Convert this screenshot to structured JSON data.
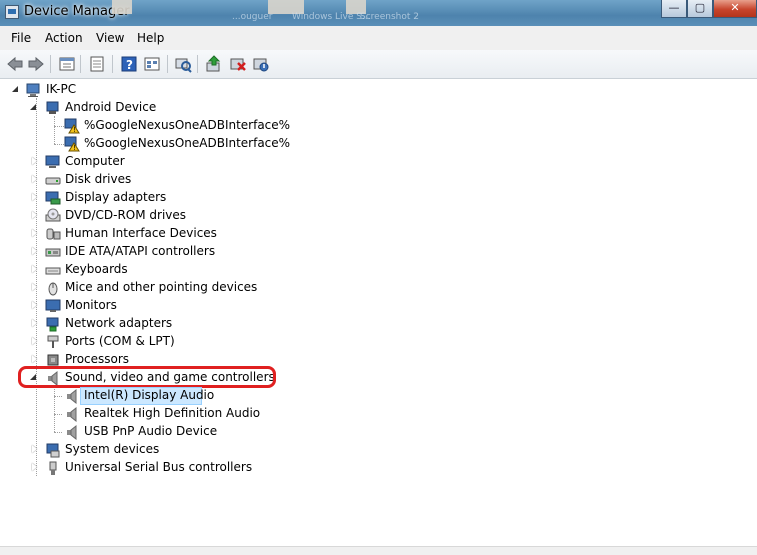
{
  "window": {
    "title": "Device Manager",
    "background_tasks": [
      "...",
      "...ouguer",
      "Windows Live S...",
      "Screenshot 2"
    ]
  },
  "menu": [
    "File",
    "Action",
    "View",
    "Help"
  ],
  "toolbar": {
    "buttons": [
      "back-icon",
      "forward-icon",
      "properties-grid-icon",
      "help-icon",
      "view-icon",
      "scan-icon",
      "update-driver-icon",
      "uninstall-icon",
      "disable-icon"
    ]
  },
  "tree": {
    "root": "IK-PC",
    "android": {
      "label": "Android Device",
      "children": [
        "%GoogleNexusOneADBInterface%",
        "%GoogleNexusOneADBInterface%"
      ]
    },
    "categories": [
      "Computer",
      "Disk drives",
      "Display adapters",
      "DVD/CD-ROM drives",
      "Human Interface Devices",
      "IDE ATA/ATAPI controllers",
      "Keyboards",
      "Mice and other pointing devices",
      "Monitors",
      "Network adapters",
      "Ports (COM & LPT)",
      "Processors"
    ],
    "sound": {
      "label": "Sound, video and game controllers",
      "children": [
        "Intel(R) Display Audio",
        "Realtek High Definition Audio",
        "USB PnP Audio Device"
      ]
    },
    "tail": [
      "System devices",
      "Universal Serial Bus controllers"
    ]
  },
  "colors": {
    "highlight": "#e02020",
    "selection": "#cce8ff"
  }
}
